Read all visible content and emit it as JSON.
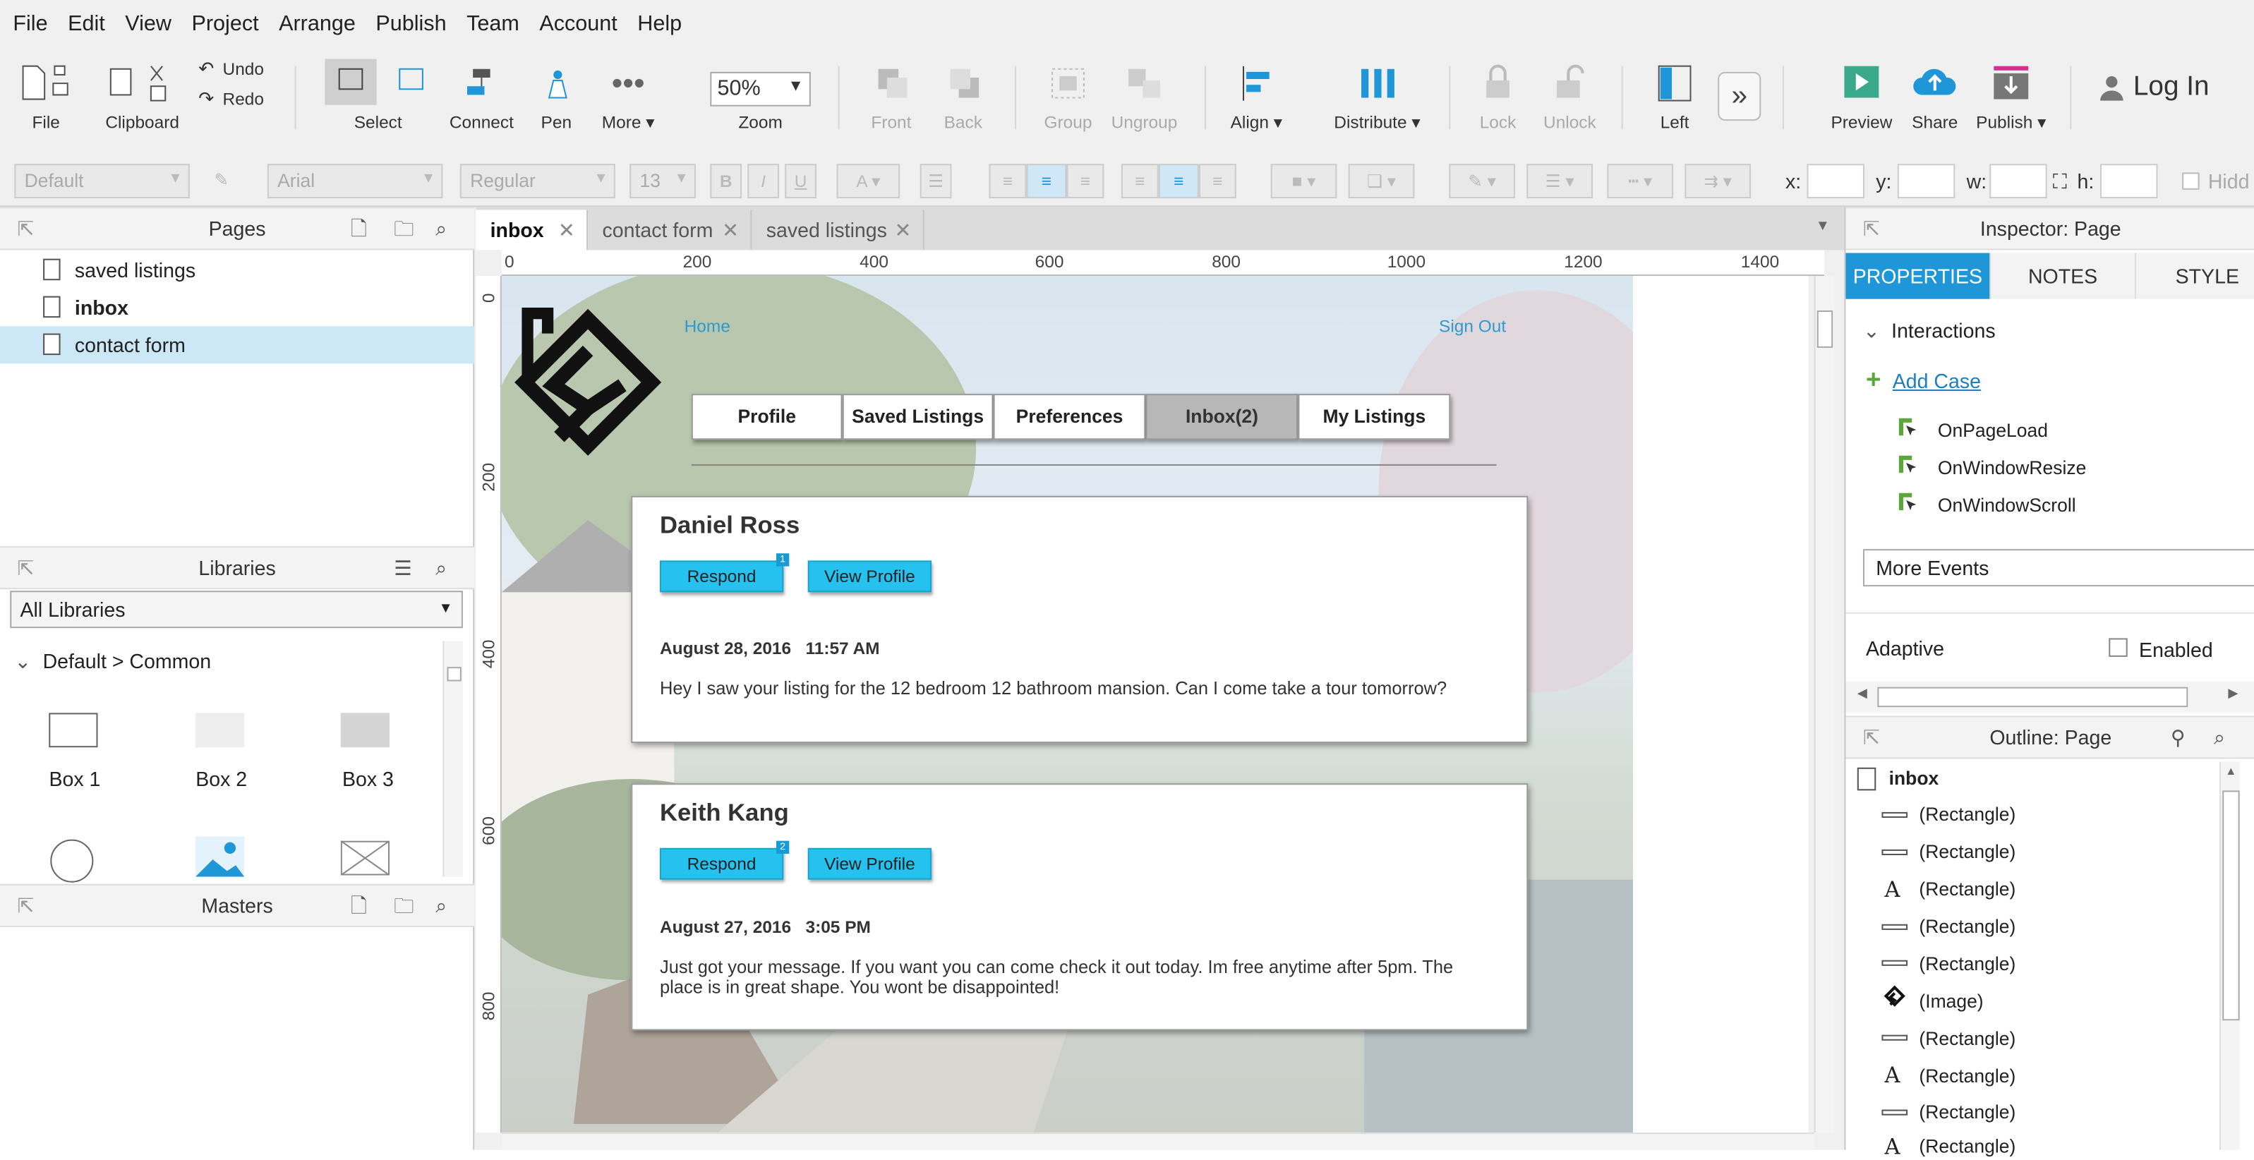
{
  "menu": [
    "File",
    "Edit",
    "View",
    "Project",
    "Arrange",
    "Publish",
    "Team",
    "Account",
    "Help"
  ],
  "toolbar": {
    "file": "File",
    "clipboard": "Clipboard",
    "undo": "Undo",
    "redo": "Redo",
    "select": "Select",
    "connect": "Connect",
    "pen": "Pen",
    "more": "More ▾",
    "zoom_value": "50%",
    "zoom": "Zoom",
    "front": "Front",
    "back": "Back",
    "group": "Group",
    "ungroup": "Ungroup",
    "align": "Align ▾",
    "distribute": "Distribute ▾",
    "lock": "Lock",
    "unlock": "Unlock",
    "left": "Left",
    "preview": "Preview",
    "share": "Share",
    "publish": "Publish ▾",
    "login": "Log In"
  },
  "format": {
    "style": "Default",
    "font": "Arial",
    "weight": "Regular",
    "size": "13",
    "x_label": "x:",
    "y_label": "y:",
    "w_label": "w:",
    "h_label": "h:",
    "hidden": "Hidd"
  },
  "pages": {
    "title": "Pages",
    "items": [
      {
        "label": "saved listings"
      },
      {
        "label": "inbox"
      },
      {
        "label": "contact form"
      }
    ]
  },
  "libraries": {
    "title": "Libraries",
    "selected": "All Libraries",
    "group": "Default > Common",
    "items": [
      "Box 1",
      "Box 2",
      "Box 3"
    ]
  },
  "masters": {
    "title": "Masters"
  },
  "tabs": [
    {
      "label": "inbox"
    },
    {
      "label": "contact form"
    },
    {
      "label": "saved listings"
    }
  ],
  "ruler": {
    "h": [
      "0",
      "200",
      "400",
      "600",
      "800",
      "1000",
      "1200",
      "1400"
    ],
    "v": [
      "0",
      "200",
      "400",
      "600",
      "800"
    ]
  },
  "design": {
    "home": "Home",
    "signout": "Sign Out",
    "nav": [
      "Profile",
      "Saved Listings",
      "Preferences",
      "Inbox(2)",
      "My Listings"
    ],
    "messages": [
      {
        "name": "Daniel Ross",
        "respond": "Respond",
        "badge": "1",
        "view": "View Profile",
        "date": "August 28, 2016   11:57 AM",
        "body": "Hey I saw your listing for the 12 bedroom 12 bathroom mansion. Can I come take a tour tomorrow?"
      },
      {
        "name": "Keith Kang",
        "respond": "Respond",
        "badge": "2",
        "view": "View Profile",
        "date": "August 27, 2016   3:05 PM",
        "body": "Just got your message. If you want you can come check it out today. Im free anytime after 5pm. The place is in great shape. You wont be disappointed!"
      }
    ]
  },
  "inspector": {
    "title": "Inspector: Page",
    "tabs": [
      "PROPERTIES",
      "NOTES",
      "STYLE"
    ],
    "interactions": "Interactions",
    "add_case": "Add Case",
    "events": [
      "OnPageLoad",
      "OnWindowResize",
      "OnWindowScroll"
    ],
    "more_events": "More Events",
    "adaptive": "Adaptive",
    "enabled": "Enabled"
  },
  "outline": {
    "title": "Outline: Page",
    "root": "inbox",
    "items": [
      "(Rectangle)",
      "(Rectangle)",
      "(Rectangle)",
      "(Rectangle)",
      "(Rectangle)",
      "(Image)",
      "(Rectangle)",
      "(Rectangle)",
      "(Rectangle)",
      "(Rectangle)"
    ]
  },
  "colors": {
    "accent": "#1e96d8",
    "button": "#25c2ef",
    "link": "#2b9bd0"
  }
}
